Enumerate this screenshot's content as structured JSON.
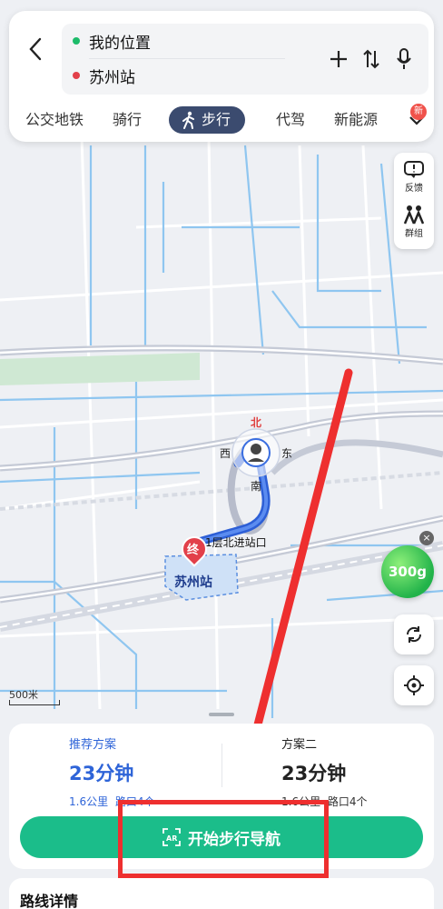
{
  "route": {
    "start_label": "我的位置",
    "end_label": "苏州站",
    "add_icon": "plus-icon",
    "swap_icon": "swap-icon",
    "voice_icon": "mic-icon"
  },
  "modes": {
    "items": [
      "公交地铁",
      "骑行",
      "步行",
      "代驾",
      "新能源"
    ],
    "active": "步行",
    "new_badge": "新"
  },
  "side_panel": {
    "feedback_label": "反馈",
    "group_label": "群组"
  },
  "map": {
    "north": "北",
    "west": "西",
    "east": "东",
    "south": "南",
    "entrance_label": "1层北进站口",
    "end_marker": "终",
    "station_label": "苏州站",
    "scale_label": "500米",
    "eco_value": "300g"
  },
  "plans": [
    {
      "tag": "推荐方案",
      "time": "23分钟",
      "distance": "1.6公里",
      "crossings": "路口4个"
    },
    {
      "tag": "方案二",
      "time": "23分钟",
      "distance": "1.6公里",
      "crossings": "路口4个"
    }
  ],
  "nav_button": {
    "label": "开始步行导航",
    "icon": "ar-icon"
  },
  "detail": {
    "title": "路线详情"
  },
  "colors": {
    "primary": "#2e64d8",
    "nav_green": "#1bbd8a",
    "active_mode": "#3b4b6f",
    "route_blue": "#3a6ee0",
    "annotation_red": "#ee2f2f"
  }
}
